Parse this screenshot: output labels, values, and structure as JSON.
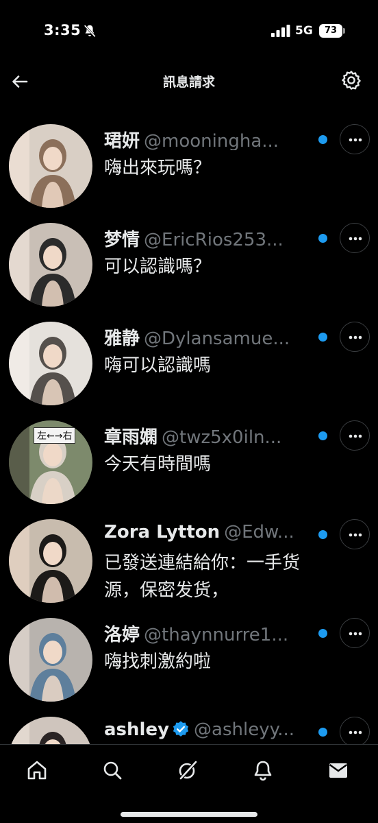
{
  "status": {
    "time": "3:35",
    "network": "5G",
    "battery": "73"
  },
  "header": {
    "title": "訊息請求"
  },
  "requests": [
    {
      "name": "珺妍",
      "handle": "@mooningha...",
      "message": "嗨出來玩嗎？",
      "unread": true,
      "avatar_colors": [
        "#d9cfc5",
        "#8b6f5a",
        "#f1e3d7"
      ]
    },
    {
      "name": "梦情",
      "handle": "@EricRios253...",
      "message": "可以認識嗎？",
      "unread": true,
      "avatar_colors": [
        "#c9bfb6",
        "#2b2b2b",
        "#efe4dc"
      ]
    },
    {
      "name": "雅静",
      "handle": "@Dylansamue...",
      "message": "嗨可以認識嗎",
      "unread": true,
      "avatar_colors": [
        "#e5e1dc",
        "#55504c",
        "#f5efe9"
      ]
    },
    {
      "name": "章雨嫻",
      "handle": "@twz5x0iln...",
      "message": "今天有時間嗎",
      "unread": true,
      "avatar_colors": [
        "#7d8a6c",
        "#d8d0c6",
        "#4a4a3c"
      ],
      "sign_text": "左←→右"
    },
    {
      "name": "Zora Lytton",
      "handle": "@Edw...",
      "message": "已發送連結給你：一手货源，保密发货，",
      "unread": true,
      "avatar_colors": [
        "#c8bcae",
        "#1c1a18",
        "#e8d6c6"
      ]
    },
    {
      "name": "洛婷",
      "handle": "@thaynnurre1...",
      "message": "嗨找刺激約啦",
      "unread": true,
      "avatar_colors": [
        "#b8b3ae",
        "#5e7f9c",
        "#e2d9d0"
      ]
    },
    {
      "name": "ashley",
      "handle": "@ashleyy...",
      "message": "",
      "unread": true,
      "verified": true,
      "avatar_colors": [
        "#cfc5bd",
        "#2a2424",
        "#e9dfd7"
      ]
    }
  ],
  "icons": {
    "back": "arrow-left-icon",
    "settings": "gear-icon",
    "more": "more-horizontal-icon",
    "nav": [
      "home-icon",
      "search-icon",
      "grok-icon",
      "notifications-icon",
      "messages-icon"
    ]
  },
  "colors": {
    "accent": "#1d9bf0",
    "text": "#e7e9ea",
    "muted": "#71767b",
    "background": "#000000"
  }
}
